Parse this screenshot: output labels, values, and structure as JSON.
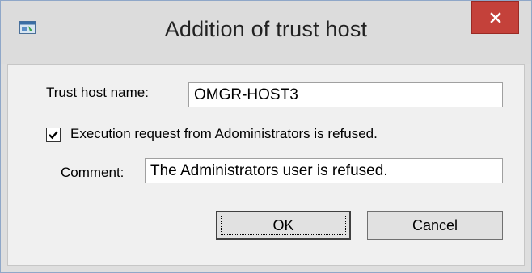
{
  "window": {
    "title": "Addition of trust host",
    "close_icon": "close-icon",
    "app_icon": "window-app-icon"
  },
  "form": {
    "trust_host_label": "Trust host name:",
    "trust_host_value": "OMGR-HOST3",
    "execution_checkbox_label": "Execution request from Adoministrators is refused.",
    "execution_checked": true,
    "comment_label": "Comment:",
    "comment_value": "The Administrators user is refused."
  },
  "buttons": {
    "ok_label": "OK",
    "cancel_label": "Cancel"
  },
  "colors": {
    "close_button": "#c4413a",
    "titlebar": "#dcdcdc",
    "client_bg": "#f0f0f0"
  }
}
